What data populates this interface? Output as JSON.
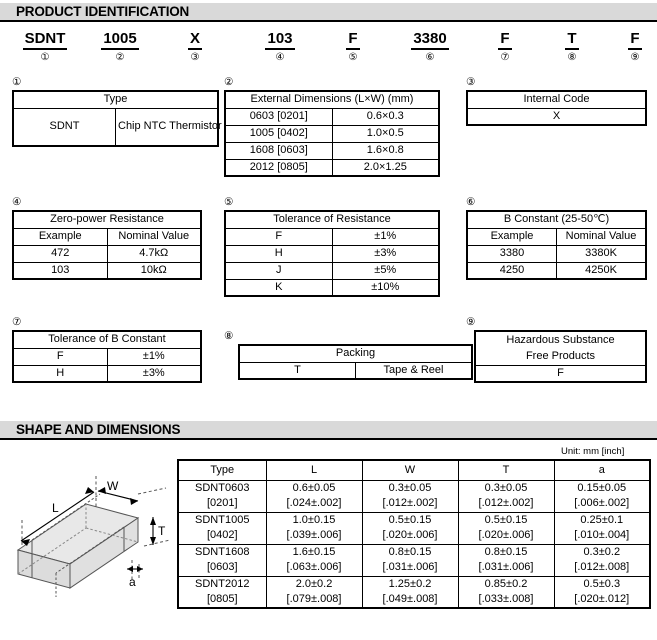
{
  "sections": {
    "product_identification": "PRODUCT IDENTIFICATION",
    "shape_and_dimensions": "SHAPE AND DIMENSIONS"
  },
  "part_code": {
    "segments": [
      {
        "code": "SDNT",
        "index": "①"
      },
      {
        "code": "1005",
        "index": "②"
      },
      {
        "code": "X",
        "index": "③"
      },
      {
        "code": "103",
        "index": "④"
      },
      {
        "code": "F",
        "index": "⑤"
      },
      {
        "code": "3380",
        "index": "⑥"
      },
      {
        "code": "F",
        "index": "⑦"
      },
      {
        "code": "T",
        "index": "⑧"
      },
      {
        "code": "F",
        "index": "⑨"
      }
    ]
  },
  "tables": {
    "type": {
      "marker": "①",
      "header": "Type",
      "rows": [
        [
          "SDNT",
          "Chip NTC Thermistor"
        ]
      ]
    },
    "external_dimensions": {
      "marker": "②",
      "header": "External Dimensions (L×W) (mm)",
      "rows": [
        [
          "0603 [0201]",
          "0.6×0.3"
        ],
        [
          "1005 [0402]",
          "1.0×0.5"
        ],
        [
          "1608 [0603]",
          "1.6×0.8"
        ],
        [
          "2012 [0805]",
          "2.0×1.25"
        ]
      ]
    },
    "internal_code": {
      "marker": "③",
      "header": "Internal Code",
      "rows": [
        [
          "X"
        ]
      ]
    },
    "zero_power_resistance": {
      "marker": "④",
      "header": "Zero-power Resistance",
      "subheader": [
        "Example",
        "Nominal Value"
      ],
      "rows": [
        [
          "472",
          "4.7kΩ"
        ],
        [
          "103",
          "10kΩ"
        ]
      ]
    },
    "tolerance_of_resistance": {
      "marker": "⑤",
      "header": "Tolerance of Resistance",
      "rows": [
        [
          "F",
          "±1%"
        ],
        [
          "H",
          "±3%"
        ],
        [
          "J",
          "±5%"
        ],
        [
          "K",
          "±10%"
        ]
      ]
    },
    "b_constant": {
      "marker": "⑥",
      "header": "B Constant (25-50℃)",
      "subheader": [
        "Example",
        "Nominal Value"
      ],
      "rows": [
        [
          "3380",
          "3380K"
        ],
        [
          "4250",
          "4250K"
        ]
      ]
    },
    "tolerance_of_b_constant": {
      "marker": "⑦",
      "header": "Tolerance of B Constant",
      "rows": [
        [
          "F",
          "±1%"
        ],
        [
          "H",
          "±3%"
        ]
      ]
    },
    "packing": {
      "marker": "⑧",
      "header": "Packing",
      "rows": [
        [
          "T",
          "Tape & Reel"
        ]
      ]
    },
    "hazardous_substance": {
      "marker": "⑨",
      "header_line1": "Hazardous Substance",
      "header_line2": "Free Products",
      "rows": [
        [
          "F"
        ]
      ]
    }
  },
  "shape": {
    "unit_note": "Unit: mm [inch]",
    "drawing_labels": {
      "L": "L",
      "W": "W",
      "T": "T",
      "a": "a"
    },
    "dimensions_table": {
      "columns": [
        "Type",
        "L",
        "W",
        "T",
        "a"
      ],
      "rows": [
        {
          "type_mm": "SDNT0603",
          "type_in": "[0201]",
          "L_mm": "0.6±0.05",
          "L_in": "[.024±.002]",
          "W_mm": "0.3±0.05",
          "W_in": "[.012±.002]",
          "T_mm": "0.3±0.05",
          "T_in": "[.012±.002]",
          "a_mm": "0.15±0.05",
          "a_in": "[.006±.002]"
        },
        {
          "type_mm": "SDNT1005",
          "type_in": "[0402]",
          "L_mm": "1.0±0.15",
          "L_in": "[.039±.006]",
          "W_mm": "0.5±0.15",
          "W_in": "[.020±.006]",
          "T_mm": "0.5±0.15",
          "T_in": "[.020±.006]",
          "a_mm": "0.25±0.1",
          "a_in": "[.010±.004]"
        },
        {
          "type_mm": "SDNT1608",
          "type_in": "[0603]",
          "L_mm": "1.6±0.15",
          "L_in": "[.063±.006]",
          "W_mm": "0.8±0.15",
          "W_in": "[.031±.006]",
          "T_mm": "0.8±0.15",
          "T_in": "[.031±.006]",
          "a_mm": "0.3±0.2",
          "a_in": "[.012±.008]"
        },
        {
          "type_mm": "SDNT2012",
          "type_in": "[0805]",
          "L_mm": "2.0±0.2",
          "L_in": "[.079±.008]",
          "W_mm": "1.25±0.2",
          "W_in": "[.049±.008]",
          "T_mm": "0.85±0.2",
          "T_in": "[.033±.008]",
          "a_mm": "0.5±0.3",
          "a_in": "[.020±.012]"
        }
      ]
    }
  },
  "colors": {
    "section_bar_bg": "#d9d9d9",
    "line": "#000000",
    "chip_face_light": "#e8e8e8",
    "chip_face_mid": "#dcdcdc"
  }
}
